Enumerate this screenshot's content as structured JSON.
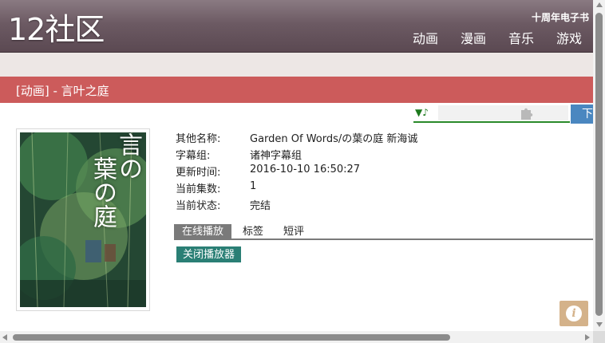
{
  "header": {
    "logo": "12社区",
    "anniversary_link": "十周年电子书",
    "nav": [
      "动画",
      "漫画",
      "音乐",
      "游戏"
    ]
  },
  "title_bar": {
    "text": "[动画] - 言叶之庭"
  },
  "player": {
    "music_icon": "♪",
    "download_label": "下"
  },
  "poster": {
    "title_line1": "言の",
    "title_line2": "葉の庭"
  },
  "info": {
    "rows": [
      {
        "key": "其他名称:",
        "value": "Garden Of Words/の葉の庭 新海诚"
      },
      {
        "key": "字幕组:",
        "value": "诸神字幕组"
      },
      {
        "key": "更新时间:",
        "value": "2016-10-10 16:50:27"
      },
      {
        "key": "当前集数:",
        "value": "1"
      },
      {
        "key": "当前状态:",
        "value": "完结"
      }
    ]
  },
  "tabs": [
    "在线播放",
    "标签",
    "短评"
  ],
  "close_player_label": "关闭播放器",
  "info_button_label": "i",
  "colors": {
    "header": "#6c5a63",
    "title_bar": "#cc5b5b",
    "close_button": "#2a7f75",
    "download_button": "#4a87c0",
    "info_button": "#d4b28a"
  },
  "icons": {
    "music": "music-note-icon",
    "puzzle": "puzzle-plugin-icon",
    "info": "info-icon"
  }
}
